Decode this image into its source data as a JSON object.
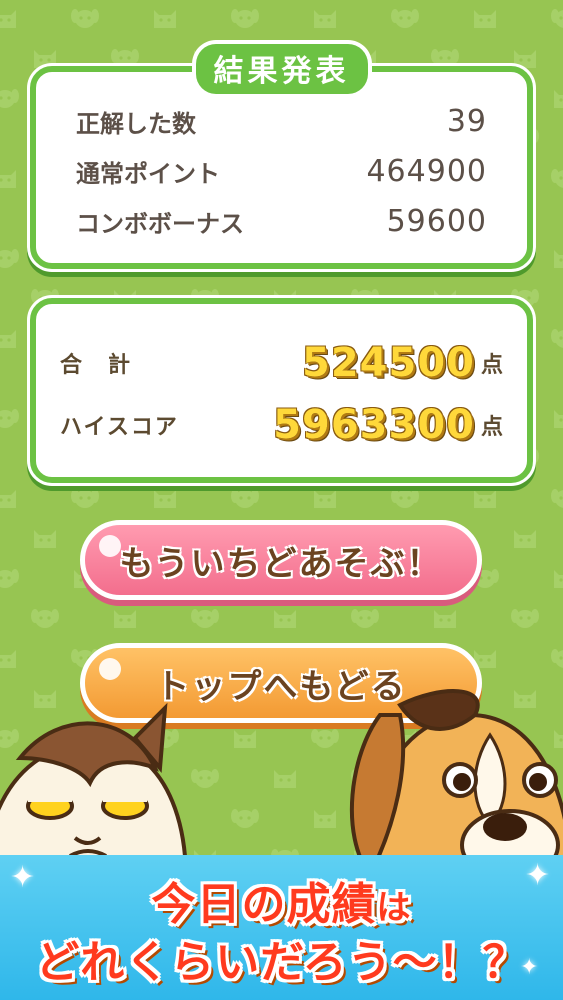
{
  "result_card": {
    "title": "結果発表",
    "rows": [
      {
        "label": "正解した数",
        "value": "39"
      },
      {
        "label": "通常ポイント",
        "value": "464900"
      },
      {
        "label": "コンボボーナス",
        "value": "59600"
      }
    ]
  },
  "total_card": {
    "total_label": "合　計",
    "total_value": "524500",
    "total_unit": "点",
    "highscore_label": "ハイスコア",
    "highscore_value": "5963300",
    "highscore_unit": "点"
  },
  "buttons": {
    "replay_label": "もういちどあそぶ！",
    "top_label": "トップへもどる"
  },
  "banner": {
    "line1_a": "今日の成績",
    "line1_b": "は",
    "line2": "どれくらいだろう〜！？"
  },
  "colors": {
    "background": "#97c552",
    "card_border": "#6cc243",
    "replay_button": "#f36e8d",
    "top_button": "#f39a33",
    "score_gold": "#ffd83a",
    "banner": "#2fb7ea",
    "banner_text": "#ff3a1e"
  },
  "icons": [
    "cat-face-pattern-icon",
    "dog-face-pattern-icon",
    "sparkle-icon"
  ]
}
